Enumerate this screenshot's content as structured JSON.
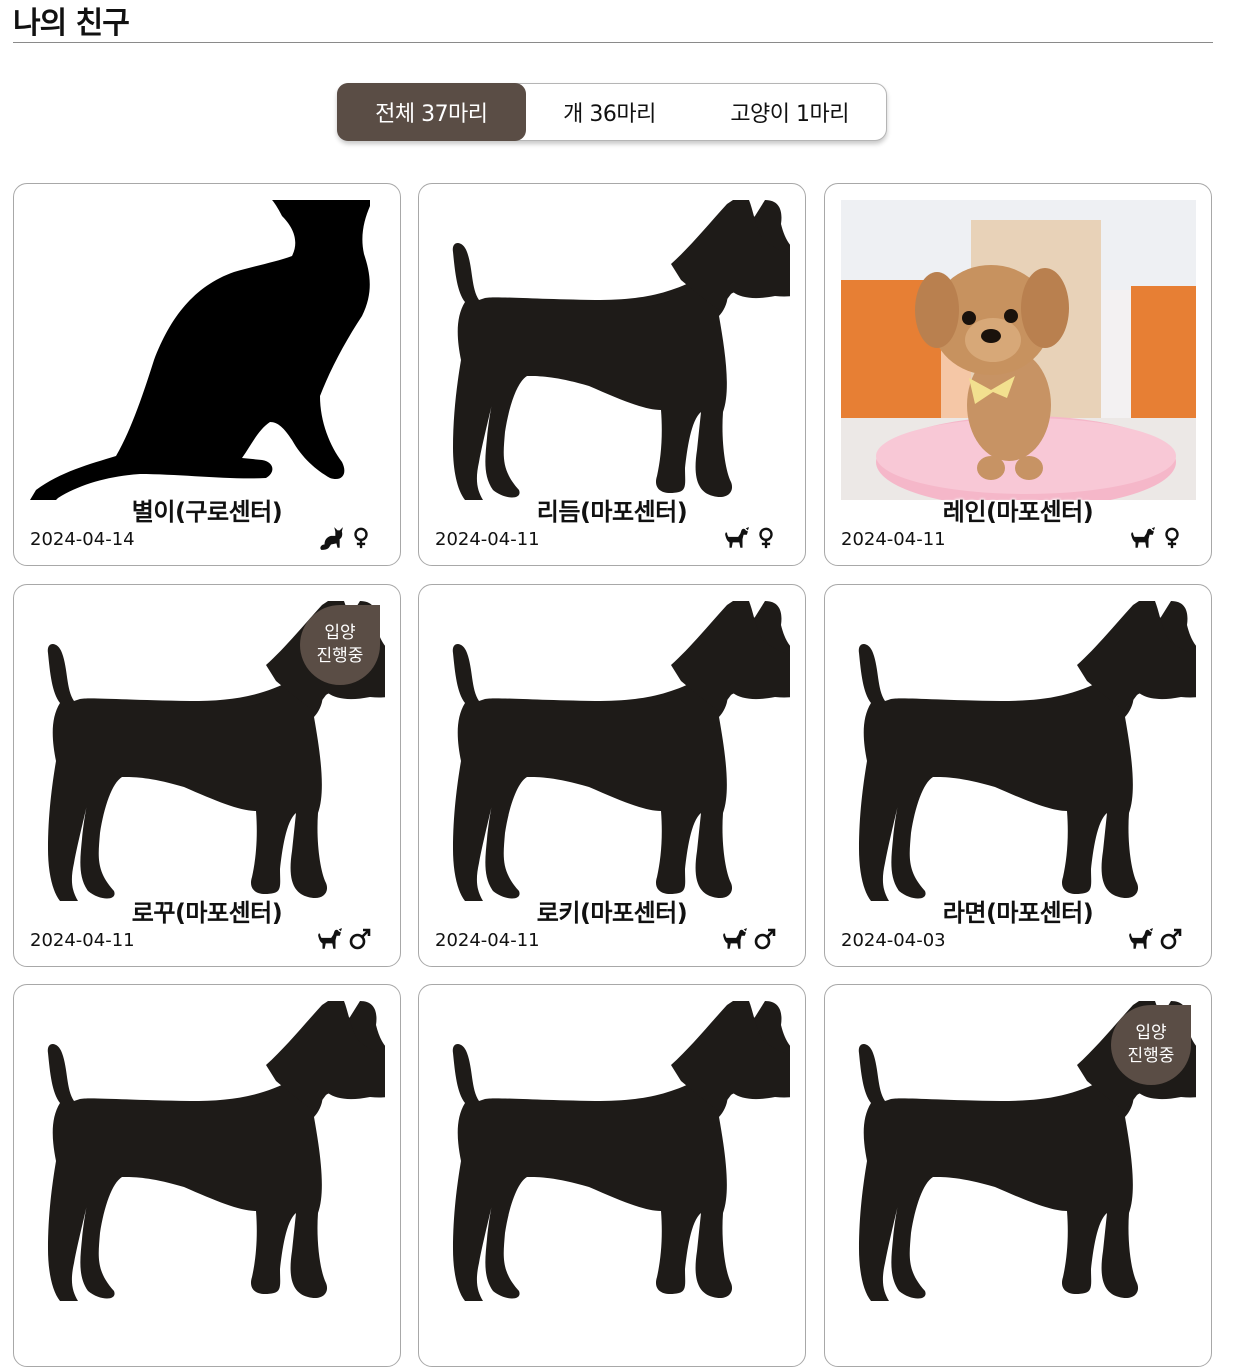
{
  "page": {
    "title": "나의 친구"
  },
  "filters": [
    {
      "label": "전체 37마리",
      "active": true
    },
    {
      "label": "개 36마리",
      "active": false
    },
    {
      "label": "고양이 1마리",
      "active": false
    }
  ],
  "cards": [
    {
      "name": "별이(구로센터)",
      "date": "2024-04-14",
      "species": "cat",
      "sex": "female",
      "badge": "",
      "photo": "cat-silhouette"
    },
    {
      "name": "리듬(마포센터)",
      "date": "2024-04-11",
      "species": "dog",
      "sex": "female",
      "badge": "",
      "photo": "dog-silhouette"
    },
    {
      "name": "레인(마포센터)",
      "date": "2024-04-11",
      "species": "dog",
      "sex": "female",
      "badge": "",
      "photo": "dog-photo"
    },
    {
      "name": "로꾸(마포센터)",
      "date": "2024-04-11",
      "species": "dog",
      "sex": "male",
      "badge": "입양\n진행중",
      "badge_line1": "입양",
      "badge_line2": "진행중",
      "photo": "dog-silhouette"
    },
    {
      "name": "로키(마포센터)",
      "date": "2024-04-11",
      "species": "dog",
      "sex": "male",
      "badge": "",
      "photo": "dog-silhouette"
    },
    {
      "name": "라면(마포센터)",
      "date": "2024-04-03",
      "species": "dog",
      "sex": "male",
      "badge": "",
      "photo": "dog-silhouette"
    },
    {
      "name": "",
      "date": "",
      "species": "dog",
      "sex": "",
      "badge": "",
      "photo": "dog-silhouette"
    },
    {
      "name": "",
      "date": "",
      "species": "dog",
      "sex": "",
      "badge": "",
      "photo": "dog-silhouette"
    },
    {
      "name": "",
      "date": "",
      "species": "dog",
      "sex": "",
      "badge": "입양\n진행중",
      "badge_line1": "입양",
      "badge_line2": "진행중",
      "photo": "dog-silhouette"
    }
  ],
  "colors": {
    "accent": "#5a4d45",
    "silhouette": "#1e1b18",
    "border": "#a8a8a8"
  },
  "icons": {
    "cat_species": "cat-icon",
    "dog_species": "dog-icon",
    "female": "female-icon",
    "male": "male-icon"
  }
}
